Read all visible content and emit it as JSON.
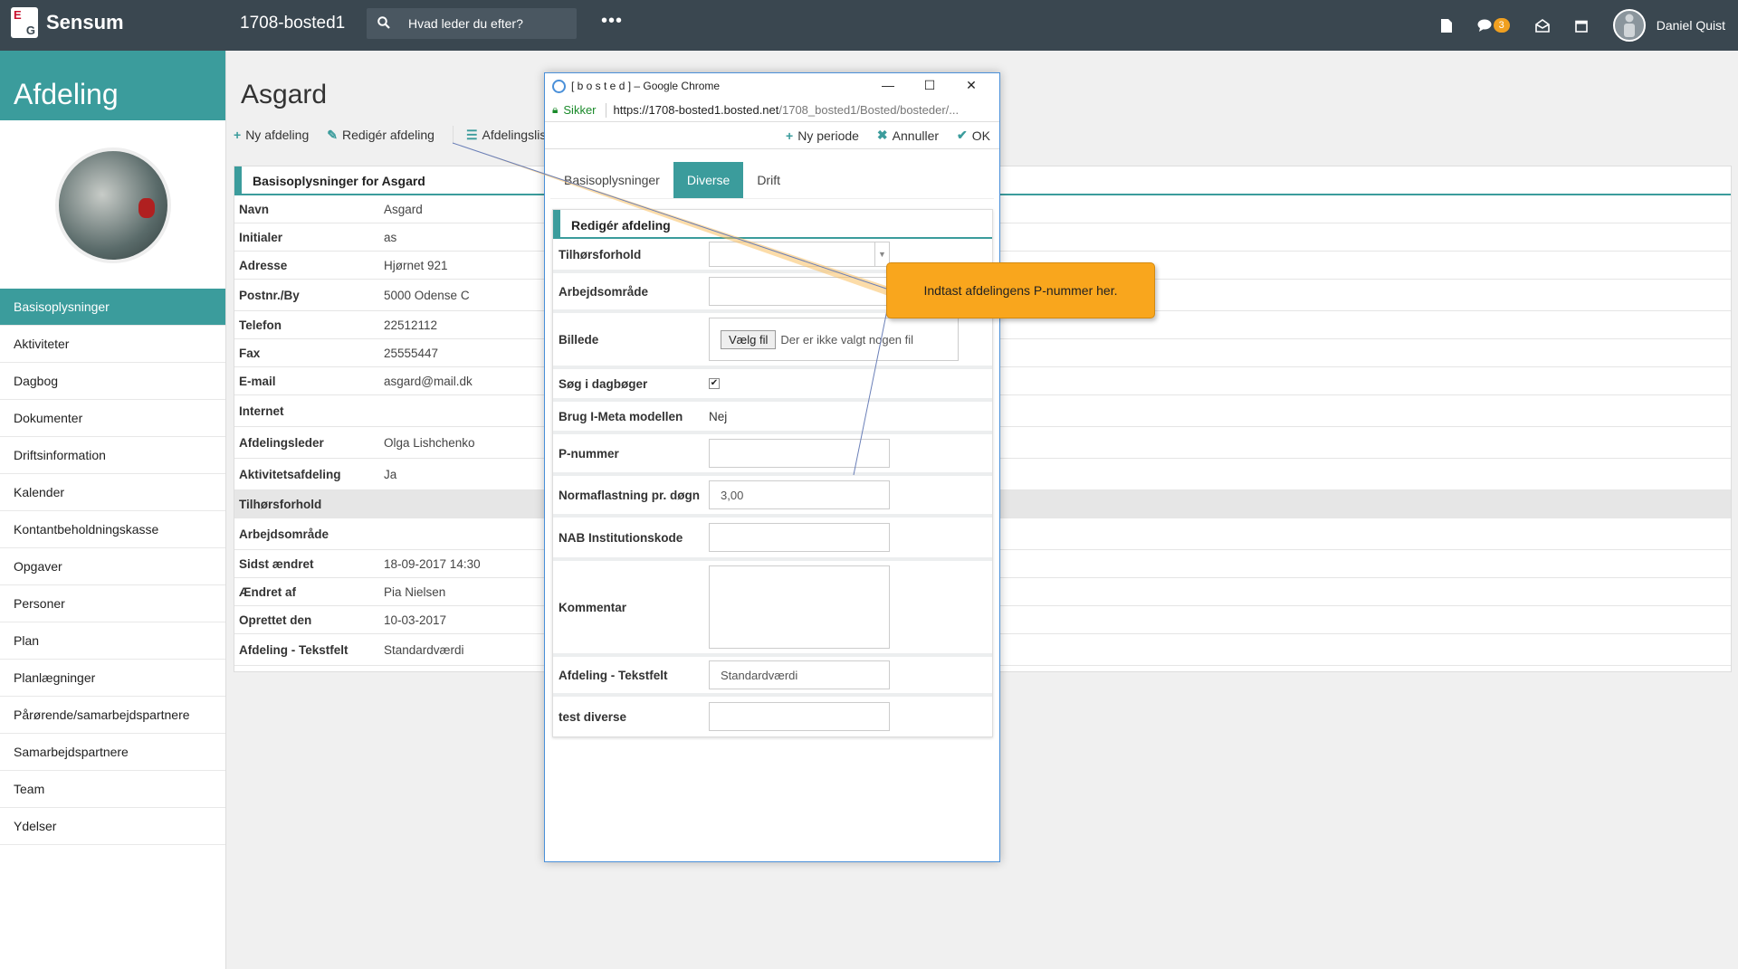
{
  "topbar": {
    "logo_letter_e": "E",
    "logo_letter_g": "G",
    "logo_text": "Sensum",
    "site_name": "1708-bosted1",
    "search_placeholder": "Hvad leder du efter?",
    "more_label": "•••",
    "messages_badge": "3",
    "user_name": "Daniel Quist"
  },
  "sidebar": {
    "title": "Afdeling",
    "items": [
      {
        "label": "Basisoplysninger",
        "active": true
      },
      {
        "label": "Aktiviteter"
      },
      {
        "label": "Dagbog"
      },
      {
        "label": "Dokumenter"
      },
      {
        "label": "Driftsinformation"
      },
      {
        "label": "Kalender"
      },
      {
        "label": "Kontantbeholdningskasse"
      },
      {
        "label": "Opgaver"
      },
      {
        "label": "Personer"
      },
      {
        "label": "Plan"
      },
      {
        "label": "Planlægninger"
      },
      {
        "label": "Pårørende/samarbejdspartnere"
      },
      {
        "label": "Samarbejdspartnere"
      },
      {
        "label": "Team"
      },
      {
        "label": "Ydelser"
      }
    ]
  },
  "main": {
    "title": "Asgard",
    "toolbar": {
      "new_label": "Ny afdeling",
      "edit_label": "Redigér afdeling",
      "list_label": "Afdelingslist"
    },
    "panel_title": "Basisoplysninger for Asgard",
    "rows": [
      {
        "k": "Navn",
        "v": "Asgard"
      },
      {
        "k": "Initialer",
        "v": "as"
      },
      {
        "k": "Adresse",
        "v": "Hjørnet 921"
      },
      {
        "k": "Postnr./By",
        "v": "5000  Odense C"
      },
      {
        "k": "Telefon",
        "v": "22512112"
      },
      {
        "k": "Fax",
        "v": "25555447"
      },
      {
        "k": "E-mail",
        "v": "asgard@mail.dk"
      },
      {
        "k": "Internet",
        "v": ""
      },
      {
        "k": "Afdelingsleder",
        "v": "Olga Lishchenko"
      },
      {
        "k": "Aktivitetsafdeling",
        "v": "Ja"
      },
      {
        "k": "Tilhørsforhold",
        "v": ""
      },
      {
        "k": "Arbejdsområde",
        "v": ""
      },
      {
        "k": "Sidst ændret",
        "v": "18-09-2017 14:30"
      },
      {
        "k": "Ændret af",
        "v": "Pia Nielsen"
      },
      {
        "k": "Oprettet den",
        "v": "10-03-2017"
      },
      {
        "k": "Afdeling - Tekstfelt",
        "v": "Standardværdi"
      }
    ]
  },
  "popup": {
    "window_title": "[ b o s t e d ] – Google Chrome",
    "secure_label": "Sikker",
    "url_main": "https://1708-bosted1.bosted.net",
    "url_rest": "/1708_bosted1/Bosted/bosteder/...",
    "toolbar": {
      "new_period": "Ny periode",
      "cancel": "Annuller",
      "ok": "OK"
    },
    "tabs": [
      "Basisoplysninger",
      "Diverse",
      "Drift"
    ],
    "form_title": "Redigér afdeling",
    "fields": {
      "tilhorsforhold": "Tilhørsforhold",
      "arbejdsomrade": "Arbejdsområde",
      "billede": "Billede",
      "file_button": "Vælg fil",
      "file_none": "Der er ikke valgt nogen fil",
      "sog_label": "Søg i dagbøger",
      "sog_checked": "✔",
      "imeta_label": "Brug I-Meta modellen",
      "imeta_value": "Nej",
      "pnummer": "P-nummer",
      "normaflastning": "Normaflastning pr. døgn",
      "normaflastning_value": "3,00",
      "nab": "NAB Institutionskode",
      "kommentar": "Kommentar",
      "tekstfelt": "Afdeling - Tekstfelt",
      "tekstfelt_value": "Standardværdi",
      "test": "test diverse"
    }
  },
  "tooltip": {
    "text": "Indtast afdelingens P-nummer her."
  }
}
